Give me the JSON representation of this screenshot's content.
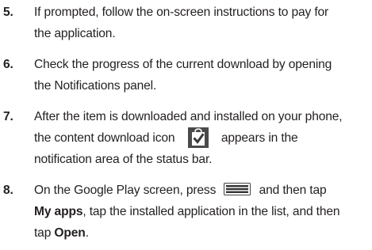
{
  "steps": [
    {
      "number": "5.",
      "line1": "If prompted, follow the on-screen instructions to pay for",
      "line2": "the application."
    },
    {
      "number": "6.",
      "line1": "Check the progress of the current download by opening",
      "line2": "the Notifications panel."
    },
    {
      "number": "7.",
      "line1": "After the item is downloaded and installed on your phone,",
      "line2_before_icon": "the content download icon",
      "line2_after_icon": "appears in the",
      "line3": "notification area of the status bar."
    },
    {
      "number": "8.",
      "line1_before_icon": "On the Google Play screen, press",
      "line1_after_icon": "and then tap",
      "line2_bold": "My apps",
      "line2_rest": ", tap the installed application in the list, and then",
      "line3_prefix": "tap ",
      "line3_bold": "Open",
      "line3_suffix": "."
    }
  ],
  "icons": {
    "content_download": "content-download-icon",
    "menu_key": "menu-key-icon"
  },
  "colors": {
    "text": "#231f20",
    "icon_dark": "#4a4a4a"
  }
}
